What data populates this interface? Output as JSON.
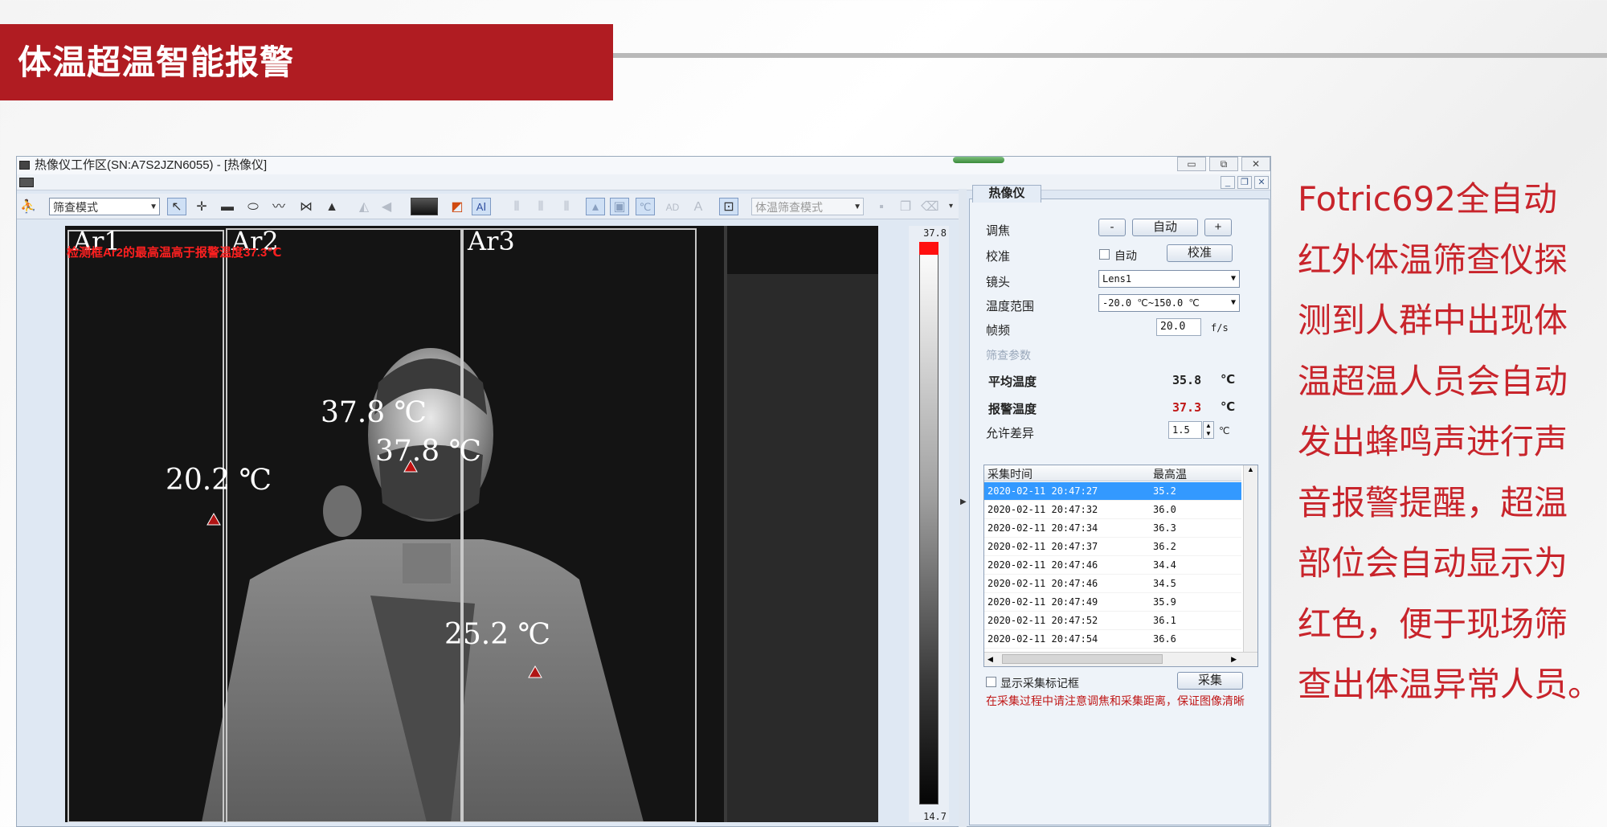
{
  "slide": {
    "title": "体温超温智能报警",
    "side_lines": [
      "Fotric692全自动",
      "红外体温筛查仪探",
      "测到人群中出现体",
      "温超温人员会自动",
      "发出蜂鸣声进行声",
      "音报警提醒，超温",
      "部位会自动显示为",
      "红色，便于现场筛",
      "查出体温异常人员。"
    ]
  },
  "window": {
    "title": "热像仪工作区(SN:A7S2JZN6055) - [热像仪]",
    "controls": [
      "▭",
      "⧉",
      "✕"
    ],
    "mdi_controls": [
      "_",
      "❐",
      "✕"
    ]
  },
  "toolbar": {
    "mode_combo": "筛查模式",
    "mode_combo2": "体温筛查模式",
    "tools": [
      {
        "icon": "run-icon",
        "glyph": "⛹"
      },
      {
        "icon": "pointer-icon",
        "glyph": "↖"
      },
      {
        "icon": "spot-icon",
        "glyph": "✛"
      },
      {
        "icon": "rectangle-icon",
        "glyph": "▬"
      },
      {
        "icon": "ellipse-icon",
        "glyph": "⬭"
      },
      {
        "icon": "polyline-icon",
        "glyph": "〰"
      },
      {
        "icon": "bowtie-icon",
        "glyph": "⋈"
      },
      {
        "icon": "triangle-icon",
        "glyph": "▲"
      }
    ]
  },
  "thermal": {
    "zones": [
      "Ar1",
      "Ar2",
      "Ar3"
    ],
    "alarm_message": "检测框Ar2的最高温高于报警温度37.3℃",
    "readings": [
      "37.8 ℃",
      "37.8 ℃",
      "20.2 ℃",
      "25.2 ℃"
    ]
  },
  "scale": {
    "max": "37.8",
    "min": "14.7"
  },
  "panel": {
    "tab": "热像仪",
    "focus_label": "调焦",
    "focus_minus": "-",
    "focus_auto": "自动",
    "focus_plus": "+",
    "calib_label": "校准",
    "calib_auto_check": "自动",
    "calib_button": "校准",
    "lens_label": "镜头",
    "lens_value": "Lens1",
    "range_label": "温度范围",
    "range_value": "-20.0 ℃~150.0 ℃",
    "fps_label": "帧频",
    "fps_value": "20.0",
    "fps_unit": "f/s",
    "screen_params": "筛查参数",
    "avg_label": "平均温度",
    "avg_value": "35.8",
    "alarm_label": "报警温度",
    "alarm_value": "37.3",
    "celsius": "℃",
    "tolerance_label": "允许差异",
    "tolerance_value": "1.5",
    "table_headers": [
      "采集时间",
      "最高温"
    ],
    "rows": [
      {
        "time": "2020-02-11 20:47:27",
        "max": "35.2"
      },
      {
        "time": "2020-02-11 20:47:32",
        "max": "36.0"
      },
      {
        "time": "2020-02-11 20:47:34",
        "max": "36.3"
      },
      {
        "time": "2020-02-11 20:47:37",
        "max": "36.2"
      },
      {
        "time": "2020-02-11 20:47:46",
        "max": "34.4"
      },
      {
        "time": "2020-02-11 20:47:46",
        "max": "34.5"
      },
      {
        "time": "2020-02-11 20:47:49",
        "max": "35.9"
      },
      {
        "time": "2020-02-11 20:47:52",
        "max": "36.1"
      },
      {
        "time": "2020-02-11 20:47:54",
        "max": "36.6"
      }
    ],
    "show_marker_label": "显示采集标记框",
    "capture_button": "采集",
    "note": "在采集过程中请注意调焦和采集距离，保证图像清晰"
  },
  "colors": {
    "brand_red": "#b01c22",
    "alarm_red": "#ff2020",
    "selection_blue": "#3399ff"
  }
}
